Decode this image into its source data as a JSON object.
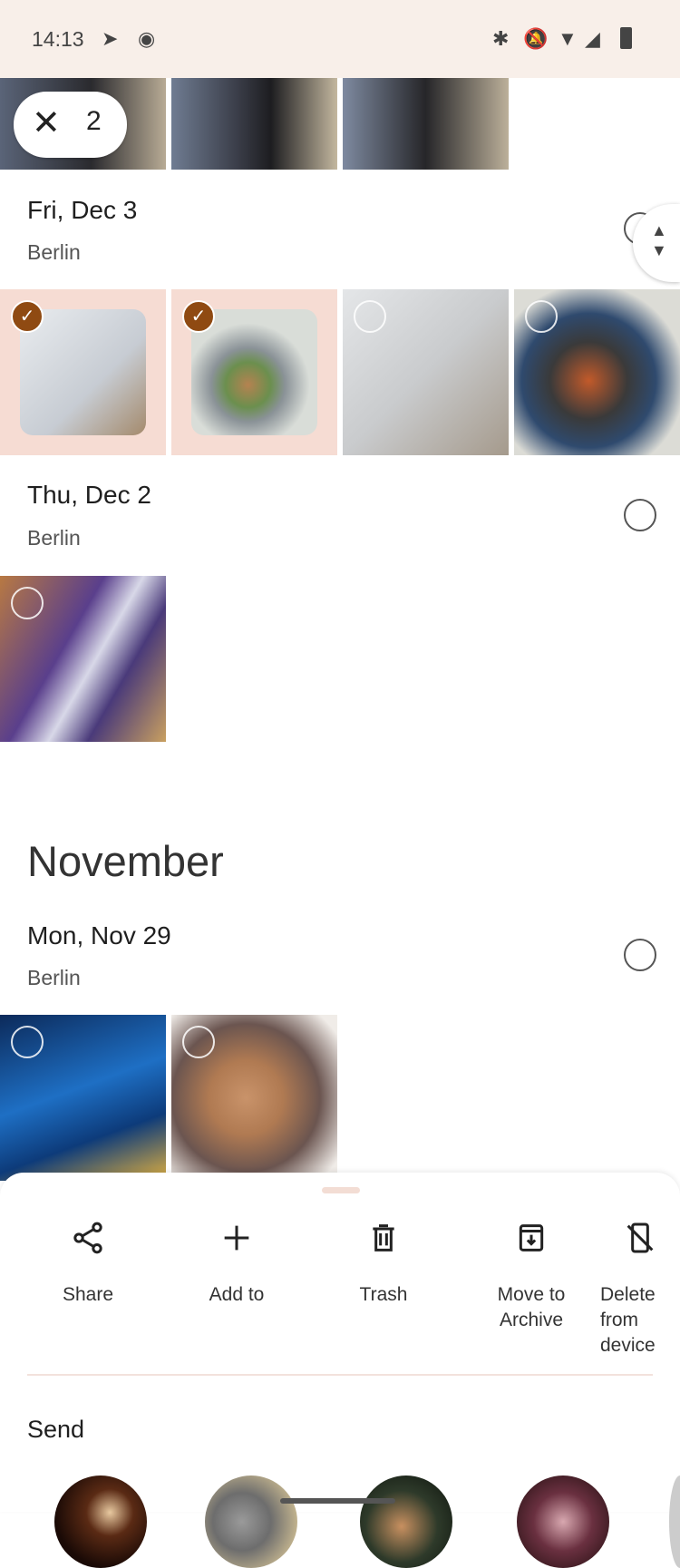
{
  "status_bar": {
    "time": "14:13",
    "icons": [
      "telegram-icon",
      "record-icon",
      "bluetooth-icon",
      "bell-off-icon",
      "wifi-icon",
      "signal-roaming-icon",
      "battery-icon"
    ]
  },
  "selection": {
    "count": "2",
    "close_icon": "close-icon"
  },
  "sections": [
    {
      "date": "Fri, Dec 3",
      "place": "Berlin"
    },
    {
      "date": "Thu, Dec 2",
      "place": "Berlin"
    },
    {
      "date": "Mon, Nov 29",
      "place": "Berlin"
    }
  ],
  "month_header": "November",
  "accent_color": "#8f4a12",
  "actions": [
    {
      "label": "Share",
      "icon": "share-icon"
    },
    {
      "label": "Add to",
      "icon": "plus-icon"
    },
    {
      "label": "Trash",
      "icon": "trash-icon"
    },
    {
      "label": "Move to\nArchive",
      "icon": "archive-icon"
    },
    {
      "label": "Delete from\ndevice",
      "icon": "delete-device-icon"
    }
  ],
  "send_label": "Send"
}
